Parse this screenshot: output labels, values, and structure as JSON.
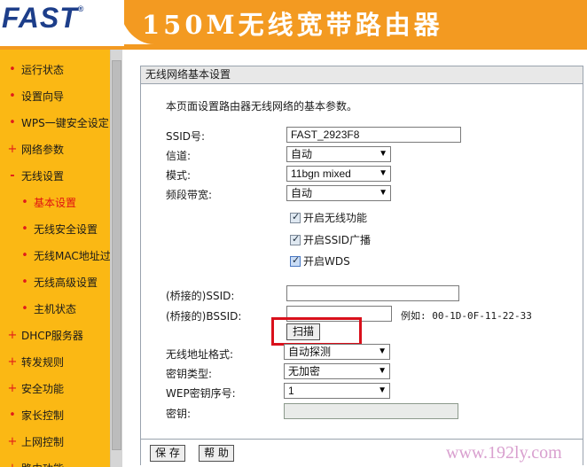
{
  "header": {
    "logo": "FAST",
    "logo_mark": "®",
    "product_title": "150M无线宽带路由器"
  },
  "sidebar": {
    "items": [
      {
        "label": "运行状态",
        "bullet": "•",
        "level": "top"
      },
      {
        "label": "设置向导",
        "bullet": "•",
        "level": "top"
      },
      {
        "label": "WPS一键安全设定",
        "bullet": "•",
        "level": "top"
      },
      {
        "label": "网络参数",
        "bullet": "+",
        "level": "top"
      },
      {
        "label": "无线设置",
        "bullet": "-",
        "level": "top"
      },
      {
        "label": "基本设置",
        "bullet": "•",
        "level": "sub",
        "active": true
      },
      {
        "label": "无线安全设置",
        "bullet": "•",
        "level": "sub"
      },
      {
        "label": "无线MAC地址过滤",
        "bullet": "•",
        "level": "sub"
      },
      {
        "label": "无线高级设置",
        "bullet": "•",
        "level": "sub"
      },
      {
        "label": "主机状态",
        "bullet": "•",
        "level": "sub"
      },
      {
        "label": "DHCP服务器",
        "bullet": "+",
        "level": "top"
      },
      {
        "label": "转发规则",
        "bullet": "+",
        "level": "top"
      },
      {
        "label": "安全功能",
        "bullet": "+",
        "level": "top"
      },
      {
        "label": "家长控制",
        "bullet": "•",
        "level": "top"
      },
      {
        "label": "上网控制",
        "bullet": "+",
        "level": "top"
      },
      {
        "label": "路由功能",
        "bullet": "+",
        "level": "top"
      }
    ]
  },
  "panel": {
    "title": "无线网络基本设置",
    "description": "本页面设置路由器无线网络的基本参数。",
    "ssid_label": "SSID号:",
    "ssid_value": "FAST_2923F8",
    "channel_label": "信道:",
    "channel_value": "自动",
    "mode_label": "模式:",
    "mode_value": "11bgn mixed",
    "bandwidth_label": "频段带宽:",
    "bandwidth_value": "自动",
    "enable_wireless": "开启无线功能",
    "enable_ssid_broadcast": "开启SSID广播",
    "enable_wds": "开启WDS",
    "bridge_ssid_label": "(桥接的)SSID:",
    "bridge_ssid_value": "",
    "bridge_bssid_label": "(桥接的)BSSID:",
    "bridge_bssid_value": "",
    "bssid_example": "例如: 00-1D-0F-11-22-33",
    "scan_button": "扫描",
    "addr_format_label": "无线地址格式:",
    "addr_format_value": "自动探测",
    "key_type_label": "密钥类型:",
    "key_type_value": "无加密",
    "wep_index_label": "WEP密钥序号:",
    "wep_index_value": "1",
    "key_label": "密钥:",
    "key_value": "",
    "save_button": "保 存",
    "help_button": "帮 助"
  },
  "watermark": "www.192ly.com",
  "colors": {
    "brand_orange": "#f39a21",
    "sidebar_yellow": "#fbb814",
    "active_red": "#e01212",
    "highlight_red": "#d9101b"
  }
}
